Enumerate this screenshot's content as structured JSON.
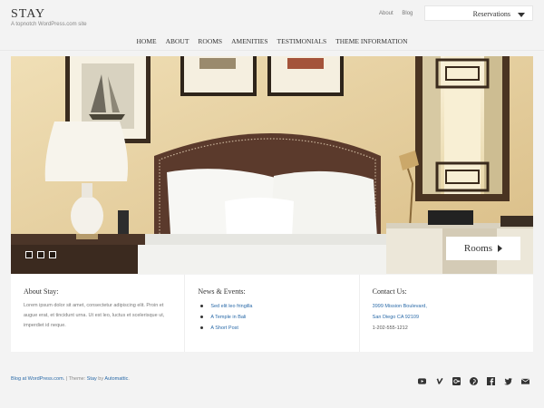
{
  "site": {
    "title": "STAY",
    "tagline": "A topnotch WordPress.com site"
  },
  "top_links": {
    "about": "About",
    "blog": "Blog"
  },
  "reservations": {
    "label": "Reservations"
  },
  "nav": [
    "HOME",
    "ABOUT",
    "ROOMS",
    "AMENITIES",
    "TESTIMONIALS",
    "THEME INFORMATION"
  ],
  "hero": {
    "button_label": "Rooms",
    "slide_count": 3
  },
  "widgets": {
    "about": {
      "title": "About Stay:",
      "text": "Lorem ipsum dolor sit amet, consectetur adipiscing elit. Proin et augue erat, et tincidunt urna. Ut est leo, luctus et scelerisque ut, imperdiet id neque."
    },
    "news": {
      "title": "News & Events:",
      "items": [
        "Sed elit leo fringilla",
        "A Temple in Bali",
        "A Short Post"
      ]
    },
    "contact": {
      "title": "Contact Us:",
      "address1": "3999 Mission Boulevard,",
      "address2": "San Diego CA 92109",
      "phone": "1-202-555-1212"
    }
  },
  "footer": {
    "blog_link": "Blog at WordPress.com.",
    "separator": " | Theme: ",
    "theme": "Stay",
    "by": " by ",
    "author": "Automattic",
    "end": "."
  },
  "social_icons": [
    "youtube-icon",
    "vimeo-icon",
    "google-plus-icon",
    "pinterest-icon",
    "facebook-icon",
    "twitter-icon",
    "email-icon"
  ]
}
